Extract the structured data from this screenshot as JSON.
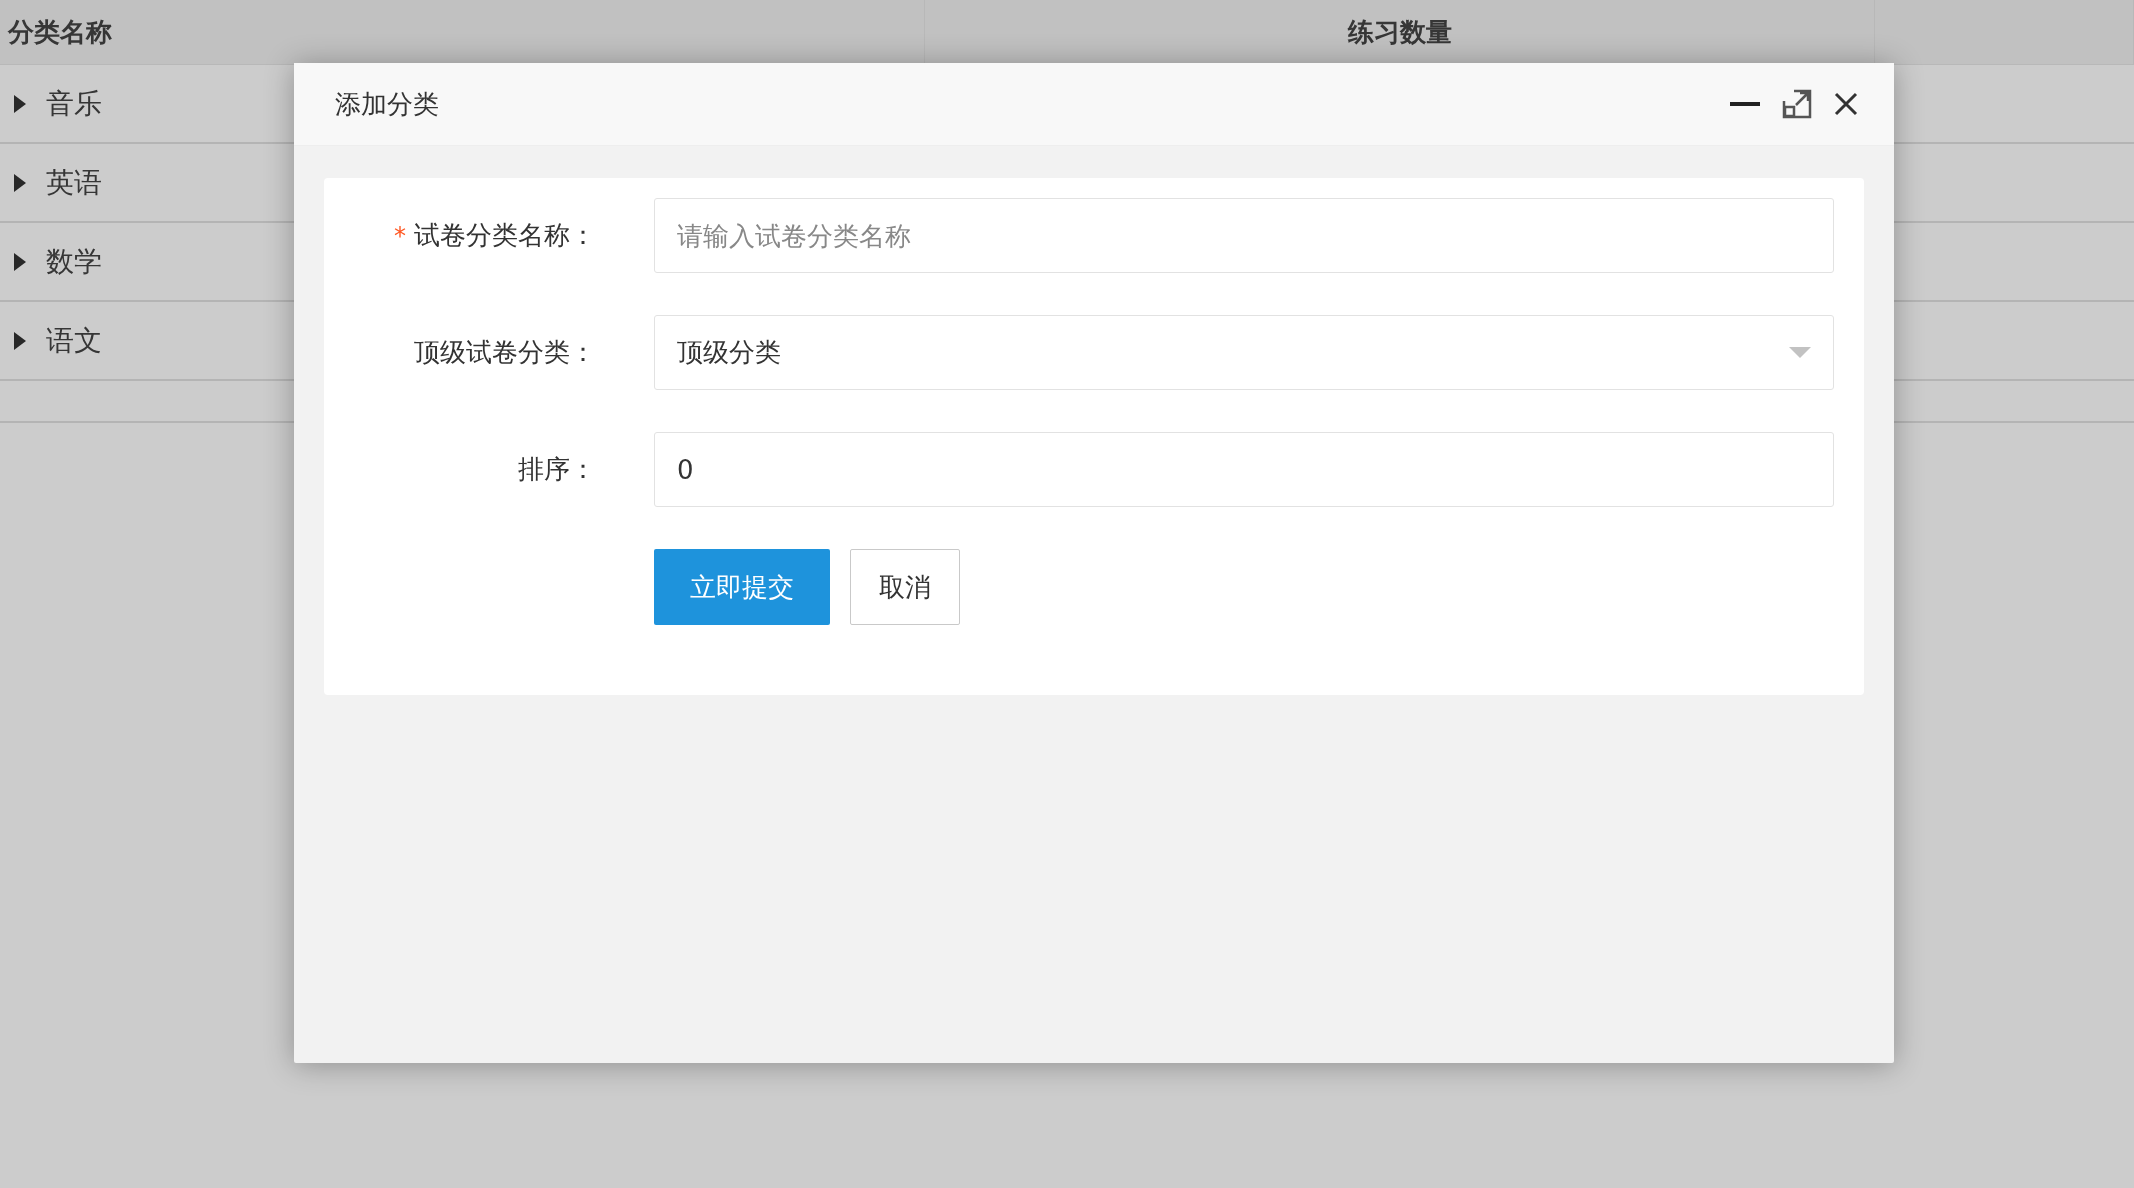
{
  "table": {
    "columns": [
      "分类名称",
      "练习数量"
    ],
    "rows": [
      {
        "name": "音乐",
        "expanded": false
      },
      {
        "name": "英语",
        "expanded": false
      },
      {
        "name": "数学",
        "expanded": false
      },
      {
        "name": "语文",
        "expanded": false
      }
    ]
  },
  "dialog": {
    "title": "添加分类",
    "fields": [
      {
        "kind": "text",
        "label": "试卷分类名称：",
        "required_mark": "*",
        "placeholder": "请输入试卷分类名称"
      },
      {
        "kind": "select",
        "label": "顶级试卷分类：",
        "value": "顶级分类"
      },
      {
        "kind": "text",
        "label": "排序：",
        "value": "0"
      }
    ],
    "buttons": [
      {
        "kind": "primary",
        "label": "立即提交"
      },
      {
        "kind": "default",
        "label": "取消"
      }
    ]
  }
}
